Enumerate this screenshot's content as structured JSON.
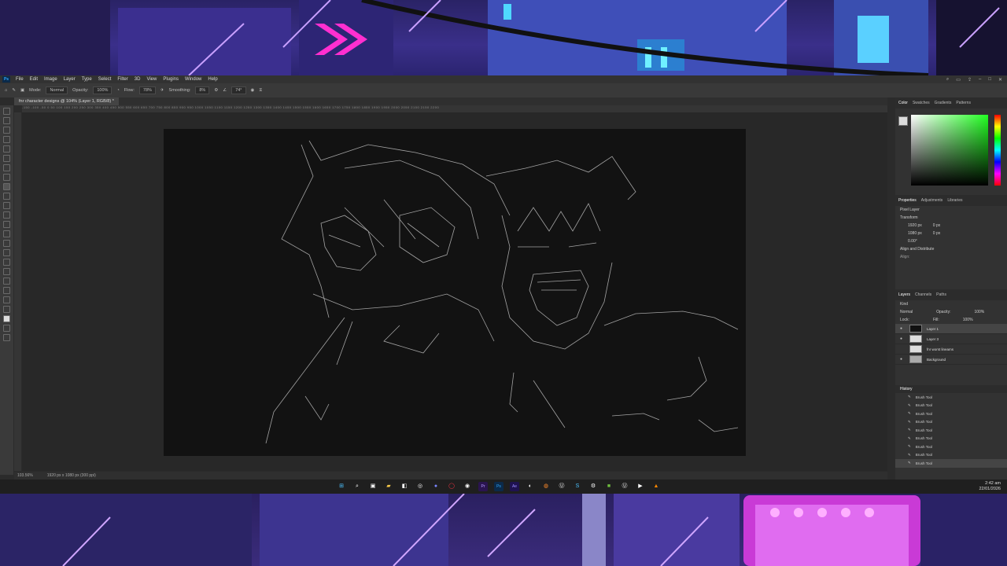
{
  "menubar": {
    "items": [
      "File",
      "Edit",
      "Image",
      "Layer",
      "Type",
      "Select",
      "Filter",
      "3D",
      "View",
      "Plugins",
      "Window",
      "Help"
    ]
  },
  "options": {
    "mode_label": "Mode:",
    "mode_value": "Normal",
    "opacity_label": "Opacity:",
    "opacity_value": "100%",
    "flow_label": "Flow:",
    "flow_value": "78%",
    "smoothing_label": "Smoothing:",
    "smoothing_value": "8%",
    "angle_value": "74°"
  },
  "document": {
    "tab_title": "fnr character designs @ 104% (Layer 1, RGB/8) *"
  },
  "ruler_ticks": "-150 -100 -50 0 50 100 150 200 250 300 350 400 450 500 550 600 650 700 750 800 850 900 950 1000 1050 1100 1150 1200 1250 1300 1350 1400 1450 1500 1550 1600 1650 1700 1750 1800 1850 1900 1950 2000 2050 2100 2150 2200",
  "status": {
    "zoom": "103.56%",
    "size": "1920 px x 1080 px (300 ppi)"
  },
  "color_panel": {
    "tabs": [
      "Color",
      "Swatches",
      "Gradients",
      "Patterns"
    ]
  },
  "properties_panel": {
    "tabs": [
      "Properties",
      "Adjustments",
      "Libraries"
    ],
    "kind": "Pixel Layer",
    "transform_label": "Transform",
    "w": "1920 px",
    "h": "1080 px",
    "x": "0 px",
    "y": "0 px",
    "angle": "0.00°",
    "align_label": "Align and Distribute",
    "align_sub": "Align:"
  },
  "layers_panel": {
    "tabs": [
      "Layers",
      "Channels",
      "Paths"
    ],
    "kind": "Kind",
    "blend": "Normal",
    "opacity_label": "Opacity:",
    "opacity": "100%",
    "lock_label": "Lock:",
    "fill_label": "Fill:",
    "fill": "100%",
    "layers": [
      {
        "name": "Layer 1",
        "selected": true
      },
      {
        "name": "Layer 3",
        "selected": false
      },
      {
        "name": "fnr worst lineams",
        "selected": false
      },
      {
        "name": "Background",
        "selected": false
      }
    ]
  },
  "history_panel": {
    "title": "History",
    "items": [
      "Brush Tool",
      "Brush Tool",
      "Brush Tool",
      "Brush Tool",
      "Brush Tool",
      "Brush Tool",
      "Brush Tool",
      "Brush Tool",
      "Brush Tool"
    ]
  },
  "taskbar": {
    "time": "2:42 am",
    "date": "22/01/2026"
  }
}
